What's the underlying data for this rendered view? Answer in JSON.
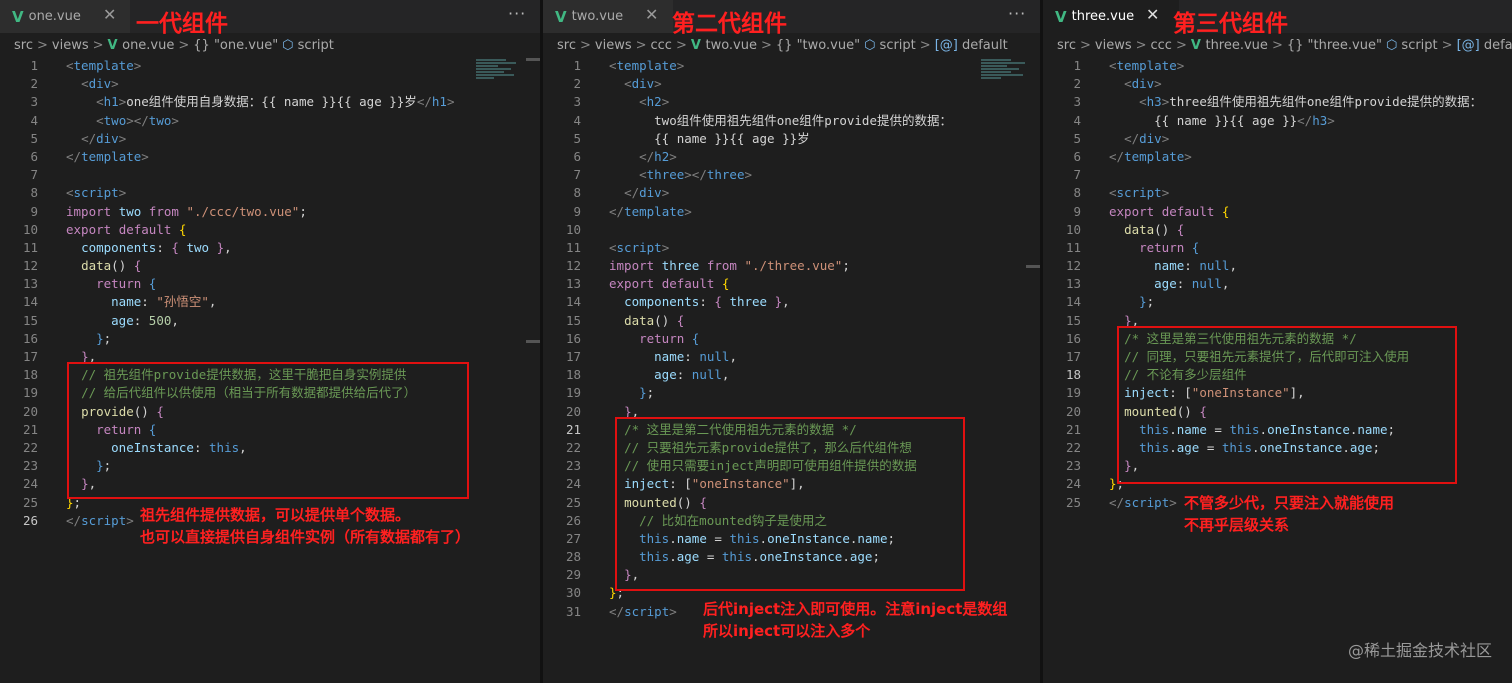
{
  "panes": [
    {
      "tab": "one.vue",
      "title": "一代组件",
      "breadcrumb": [
        "src",
        "views",
        "one.vue",
        "{} \"one.vue\"",
        "script"
      ],
      "lines": [
        {
          "n": "1",
          "html": "<span class='t'>&lt;</span><span class='tg'>template</span><span class='t'>&gt;</span>"
        },
        {
          "n": "2",
          "html": "  <span class='t'>&lt;</span><span class='tg'>div</span><span class='t'>&gt;</span>"
        },
        {
          "n": "3",
          "html": "    <span class='t'>&lt;</span><span class='tg'>h1</span><span class='t'>&gt;</span>one组件使用自身数据：{{ name }}{{ age }}岁<span class='t'>&lt;/</span><span class='tg'>h1</span><span class='t'>&gt;</span>"
        },
        {
          "n": "4",
          "html": "    <span class='t'>&lt;</span><span class='tg'>two</span><span class='t'>&gt;&lt;/</span><span class='tg'>two</span><span class='t'>&gt;</span>"
        },
        {
          "n": "5",
          "html": "  <span class='t'>&lt;/</span><span class='tg'>div</span><span class='t'>&gt;</span>"
        },
        {
          "n": "6",
          "html": "<span class='t'>&lt;/</span><span class='tg'>template</span><span class='t'>&gt;</span>"
        },
        {
          "n": "7",
          "html": ""
        },
        {
          "n": "8",
          "html": "<span class='t'>&lt;</span><span class='tg'>script</span><span class='t'>&gt;</span>"
        },
        {
          "n": "9",
          "html": "<span class='k'>import</span> <span class='p'>two</span> <span class='k'>from</span> <span class='s'>\"./ccc/two.vue\"</span>;"
        },
        {
          "n": "10",
          "html": "<span class='k'>export</span> <span class='k'>default</span> <span class='y'>{</span>"
        },
        {
          "n": "11",
          "html": "  <span class='p'>components</span>: <span class='k'>{</span> <span class='p'>two</span> <span class='k'>}</span>,"
        },
        {
          "n": "12",
          "html": "  <span class='f'>data</span>() <span class='k'>{</span>"
        },
        {
          "n": "13",
          "html": "    <span class='k'>return</span> <span class='kw'>{</span>"
        },
        {
          "n": "14",
          "html": "      <span class='p'>name</span>: <span class='s'>\"孙悟空\"</span>,"
        },
        {
          "n": "15",
          "html": "      <span class='p'>age</span>: <span class='n'>500</span>,"
        },
        {
          "n": "16",
          "html": "    <span class='kw'>}</span>;"
        },
        {
          "n": "17",
          "html": "  <span class='k'>}</span>,"
        },
        {
          "n": "18",
          "html": "  <span class='c'>// 祖先组件provide提供数据，这里干脆把自身实例提供</span>"
        },
        {
          "n": "19",
          "html": "  <span class='c'>// 给后代组件以供使用（相当于所有数据都提供给后代了）</span>"
        },
        {
          "n": "20",
          "html": "  <span class='f'>provide</span>() <span class='k'>{</span>"
        },
        {
          "n": "21",
          "html": "    <span class='k'>return</span> <span class='kw'>{</span>"
        },
        {
          "n": "22",
          "html": "      <span class='p'>oneInstance</span>: <span class='kw'>this</span>,"
        },
        {
          "n": "23",
          "html": "    <span class='kw'>}</span>;"
        },
        {
          "n": "24",
          "html": "  <span class='k'>}</span>,"
        },
        {
          "n": "25",
          "html": "<span class='y'>}</span>;"
        },
        {
          "n": "26",
          "html": "<span class='t'>&lt;/</span><span class='tg'>script</span><span class='t'>&gt;</span>",
          "cur": true
        }
      ],
      "notes": [
        "祖先组件提供数据，可以提供单个数据。",
        "也可以直接提供自身组件实例（所有数据都有了）"
      ]
    },
    {
      "tab": "two.vue",
      "title": "第二代组件",
      "breadcrumb": [
        "src",
        "views",
        "ccc",
        "two.vue",
        "{} \"two.vue\"",
        "script",
        "default"
      ],
      "lines": [
        {
          "n": "1",
          "html": "<span class='t'>&lt;</span><span class='tg'>template</span><span class='t'>&gt;</span>"
        },
        {
          "n": "2",
          "html": "  <span class='t'>&lt;</span><span class='tg'>div</span><span class='t'>&gt;</span>"
        },
        {
          "n": "3",
          "html": "    <span class='t'>&lt;</span><span class='tg'>h2</span><span class='t'>&gt;</span>"
        },
        {
          "n": "4",
          "html": "      two组件使用祖先组件one组件provide提供的数据："
        },
        {
          "n": "5",
          "html": "      {{ name }}{{ age }}岁"
        },
        {
          "n": "6",
          "html": "    <span class='t'>&lt;/</span><span class='tg'>h2</span><span class='t'>&gt;</span>"
        },
        {
          "n": "7",
          "html": "    <span class='t'>&lt;</span><span class='tg'>three</span><span class='t'>&gt;&lt;/</span><span class='tg'>three</span><span class='t'>&gt;</span>"
        },
        {
          "n": "8",
          "html": "  <span class='t'>&lt;/</span><span class='tg'>div</span><span class='t'>&gt;</span>"
        },
        {
          "n": "9",
          "html": "<span class='t'>&lt;/</span><span class='tg'>template</span><span class='t'>&gt;</span>"
        },
        {
          "n": "10",
          "html": ""
        },
        {
          "n": "11",
          "html": "<span class='t'>&lt;</span><span class='tg'>script</span><span class='t'>&gt;</span>"
        },
        {
          "n": "12",
          "html": "<span class='k'>import</span> <span class='p'>three</span> <span class='k'>from</span> <span class='s'>\"./three.vue\"</span>;"
        },
        {
          "n": "13",
          "html": "<span class='k'>export</span> <span class='k'>default</span> <span class='y'>{</span>"
        },
        {
          "n": "14",
          "html": "  <span class='p'>components</span>: <span class='k'>{</span> <span class='p'>three</span> <span class='k'>}</span>,"
        },
        {
          "n": "15",
          "html": "  <span class='f'>data</span>() <span class='k'>{</span>"
        },
        {
          "n": "16",
          "html": "    <span class='k'>return</span> <span class='kw'>{</span>"
        },
        {
          "n": "17",
          "html": "      <span class='p'>name</span>: <span class='kw'>null</span>,"
        },
        {
          "n": "18",
          "html": "      <span class='p'>age</span>: <span class='kw'>null</span>,"
        },
        {
          "n": "19",
          "html": "    <span class='kw'>}</span>;"
        },
        {
          "n": "20",
          "html": "  <span class='k'>}</span>,"
        },
        {
          "n": "21",
          "html": "  <span class='c'>/* 这里是第二代使用祖先元素的数据 */</span>",
          "cur": true
        },
        {
          "n": "22",
          "html": "  <span class='c'>// 只要祖先元素provide提供了，那么后代组件想</span>"
        },
        {
          "n": "23",
          "html": "  <span class='c'>// 使用只需要inject声明即可使用组件提供的数据</span>"
        },
        {
          "n": "24",
          "html": "  <span class='p'>inject</span>: [<span class='s'>\"oneInstance\"</span>],"
        },
        {
          "n": "25",
          "html": "  <span class='f'>mounted</span>() <span class='k'>{</span>"
        },
        {
          "n": "26",
          "html": "    <span class='c'>// 比如在mounted钩子是使用之</span>"
        },
        {
          "n": "27",
          "html": "    <span class='kw'>this</span>.<span class='p'>name</span> = <span class='kw'>this</span>.<span class='p'>oneInstance</span>.<span class='p'>name</span>;"
        },
        {
          "n": "28",
          "html": "    <span class='kw'>this</span>.<span class='p'>age</span> = <span class='kw'>this</span>.<span class='p'>oneInstance</span>.<span class='p'>age</span>;"
        },
        {
          "n": "29",
          "html": "  <span class='k'>}</span>,"
        },
        {
          "n": "30",
          "html": "<span class='y'>}</span>;"
        },
        {
          "n": "31",
          "html": "<span class='t'>&lt;/</span><span class='tg'>script</span><span class='t'>&gt;</span>"
        }
      ],
      "notes": [
        "后代inject注入即可使用。注意inject是数组",
        "所以inject可以注入多个"
      ]
    },
    {
      "tab": "three.vue",
      "title": "第三代组件",
      "breadcrumb": [
        "src",
        "views",
        "ccc",
        "three.vue",
        "{} \"three.vue\"",
        "script",
        "default"
      ],
      "lines": [
        {
          "n": "1",
          "html": "<span class='t'>&lt;</span><span class='tg'>template</span><span class='t'>&gt;</span>"
        },
        {
          "n": "2",
          "html": "  <span class='t'>&lt;</span><span class='tg'>div</span><span class='t'>&gt;</span>"
        },
        {
          "n": "3",
          "html": "    <span class='t'>&lt;</span><span class='tg'>h3</span><span class='t'>&gt;</span>three组件使用祖先组件one组件provide提供的数据："
        },
        {
          "n": "4",
          "html": "      {{ name }}{{ age }}<span class='t'>&lt;/</span><span class='tg'>h3</span><span class='t'>&gt;</span>"
        },
        {
          "n": "5",
          "html": "  <span class='t'>&lt;/</span><span class='tg'>div</span><span class='t'>&gt;</span>"
        },
        {
          "n": "6",
          "html": "<span class='t'>&lt;/</span><span class='tg'>template</span><span class='t'>&gt;</span>"
        },
        {
          "n": "7",
          "html": ""
        },
        {
          "n": "8",
          "html": "<span class='t'>&lt;</span><span class='tg'>script</span><span class='t'>&gt;</span>"
        },
        {
          "n": "9",
          "html": "<span class='k'>export</span> <span class='k'>default</span> <span class='y'>{</span>"
        },
        {
          "n": "10",
          "html": "  <span class='f'>data</span>() <span class='k'>{</span>"
        },
        {
          "n": "11",
          "html": "    <span class='k'>return</span> <span class='kw'>{</span>"
        },
        {
          "n": "12",
          "html": "      <span class='p'>name</span>: <span class='kw'>null</span>,"
        },
        {
          "n": "13",
          "html": "      <span class='p'>age</span>: <span class='kw'>null</span>,"
        },
        {
          "n": "14",
          "html": "    <span class='kw'>}</span>;"
        },
        {
          "n": "15",
          "html": "  <span class='k'>}</span>,"
        },
        {
          "n": "16",
          "html": "  <span class='c'>/* 这里是第三代使用祖先元素的数据 */</span>"
        },
        {
          "n": "17",
          "html": "  <span class='c'>// 同理，只要祖先元素提供了，后代即可注入使用</span>"
        },
        {
          "n": "18",
          "html": "  <span class='c'>// 不论有多少层组件</span>",
          "cur": true
        },
        {
          "n": "19",
          "html": "  <span class='p'>inject</span>: [<span class='s'>\"oneInstance\"</span>],"
        },
        {
          "n": "20",
          "html": "  <span class='f'>mounted</span>() <span class='k'>{</span>"
        },
        {
          "n": "21",
          "html": "    <span class='kw'>this</span>.<span class='p'>name</span> = <span class='kw'>this</span>.<span class='p'>oneInstance</span>.<span class='p'>name</span>;"
        },
        {
          "n": "22",
          "html": "    <span class='kw'>this</span>.<span class='p'>age</span> = <span class='kw'>this</span>.<span class='p'>oneInstance</span>.<span class='p'>age</span>;"
        },
        {
          "n": "23",
          "html": "  <span class='k'>}</span>,"
        },
        {
          "n": "24",
          "html": "<span class='y'>}</span>;"
        },
        {
          "n": "25",
          "html": "<span class='t'>&lt;/</span><span class='tg'>script</span><span class='t'>&gt;</span>"
        }
      ],
      "notes": [
        "不管多少代，只要注入就能使用",
        "不再乎层级关系"
      ]
    }
  ],
  "watermark": "@稀土掘金技术社区",
  "colors": {
    "annotation": "#ff2020",
    "vue": "#41b883",
    "background": "#1e1e1e"
  }
}
